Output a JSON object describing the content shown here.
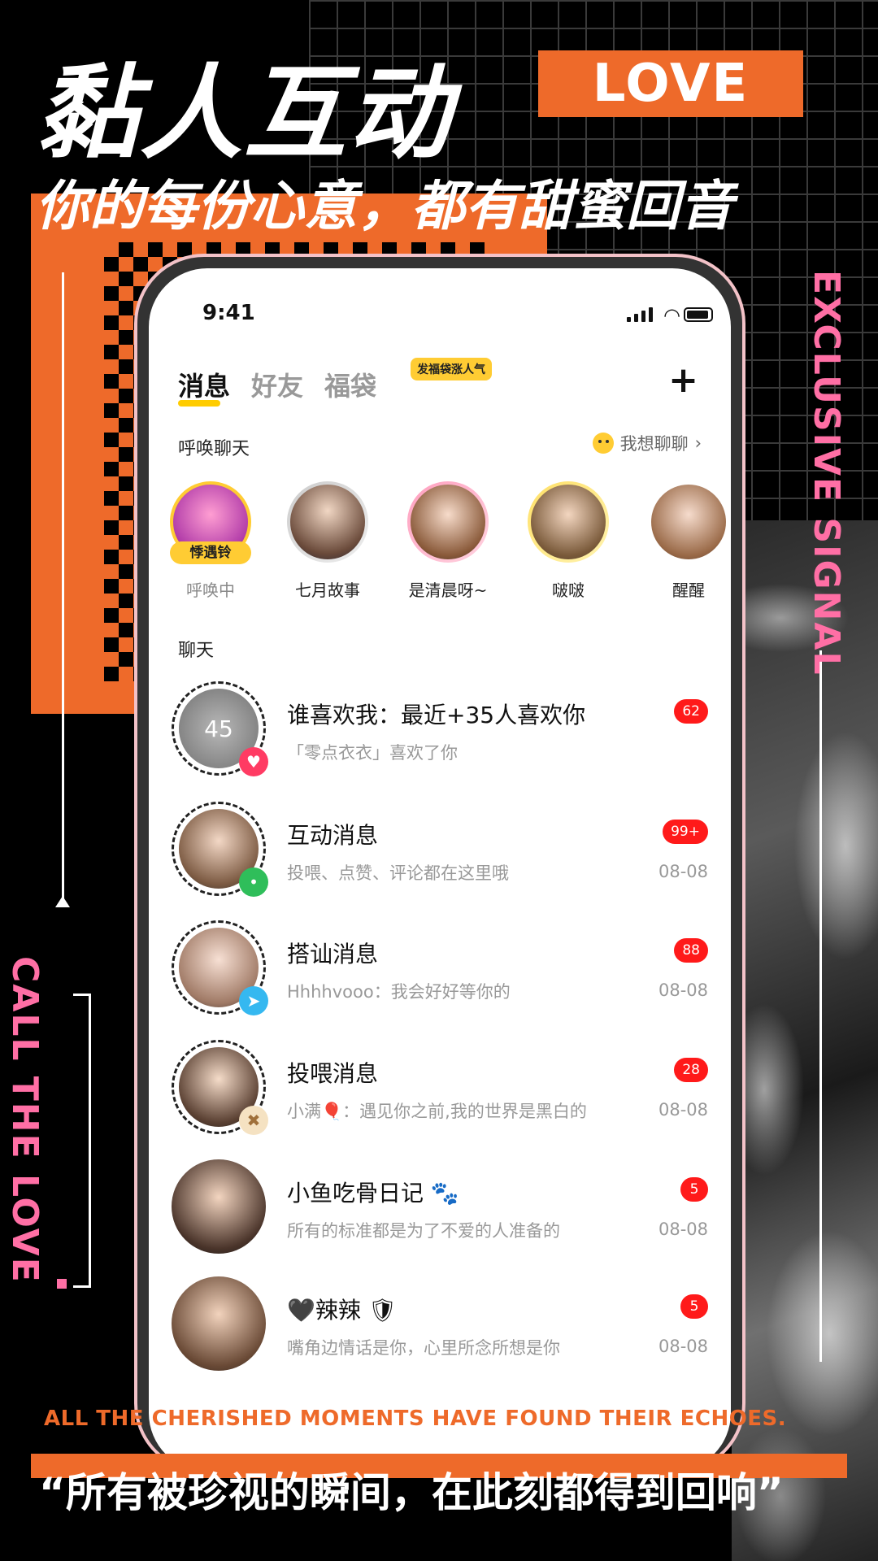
{
  "poster": {
    "headline": "黏人互动",
    "love_badge": "LOVE",
    "subhead": "你的每份心意，都有甜蜜回音",
    "vertical_right": "EXCLUSIVE SIGNAL",
    "vertical_left": "CALL THE LOVE",
    "slogan_en": "ALL THE CHERISHED MOMENTS HAVE FOUND THEIR ECHOES.",
    "quote_cn": "“所有被珍视的瞬间，在此刻都得到回响”",
    "colors": {
      "accent_orange": "#ee6a2a",
      "accent_pink": "#ff6fa5",
      "badge_red": "#ff1a1a",
      "highlight_yellow": "#ffcc33"
    }
  },
  "status_bar": {
    "time": "9:41",
    "icons": [
      "signal-icon",
      "wifi-icon",
      "battery-icon"
    ]
  },
  "tabs": {
    "items": [
      {
        "label": "消息",
        "active": true
      },
      {
        "label": "好友",
        "active": false
      },
      {
        "label": "福袋",
        "active": false
      }
    ],
    "gift_badge": "发福袋涨人气",
    "add_icon": "plus-icon"
  },
  "summon": {
    "title": "呼唤聊天",
    "link": "我想聊聊",
    "items": [
      {
        "name": "呼唤中",
        "tag": "悸遇铃"
      },
      {
        "name": "七月故事"
      },
      {
        "name": "是清晨呀~"
      },
      {
        "name": "啵啵"
      },
      {
        "name": "醒醒"
      }
    ]
  },
  "chats": {
    "title": "聊天",
    "items": [
      {
        "title": "谁喜欢我：最近+35人喜欢你",
        "preview": "「零点衣衣」喜欢了你",
        "badge": "62",
        "date": "",
        "avatar_text": "45"
      },
      {
        "title": "互动消息",
        "preview": "投喂、点赞、评论都在这里哦",
        "badge": "99+",
        "date": "08-08"
      },
      {
        "title": "搭讪消息",
        "preview": "Hhhhvooo：我会好好等你的",
        "badge": "88",
        "date": "08-08"
      },
      {
        "title": "投喂消息",
        "preview": "小满🎈：遇见你之前,我的世界是黑白的",
        "badge": "28",
        "date": "08-08"
      },
      {
        "title": "小鱼吃骨日记 🐾",
        "preview": "所有的标准都是为了不爱的人准备的",
        "badge": "5",
        "date": "08-08"
      },
      {
        "title": "🖤辣辣 🛡",
        "preview": "嘴角边情话是你，心里所念所想是你",
        "badge": "5",
        "date": "08-08"
      }
    ]
  }
}
